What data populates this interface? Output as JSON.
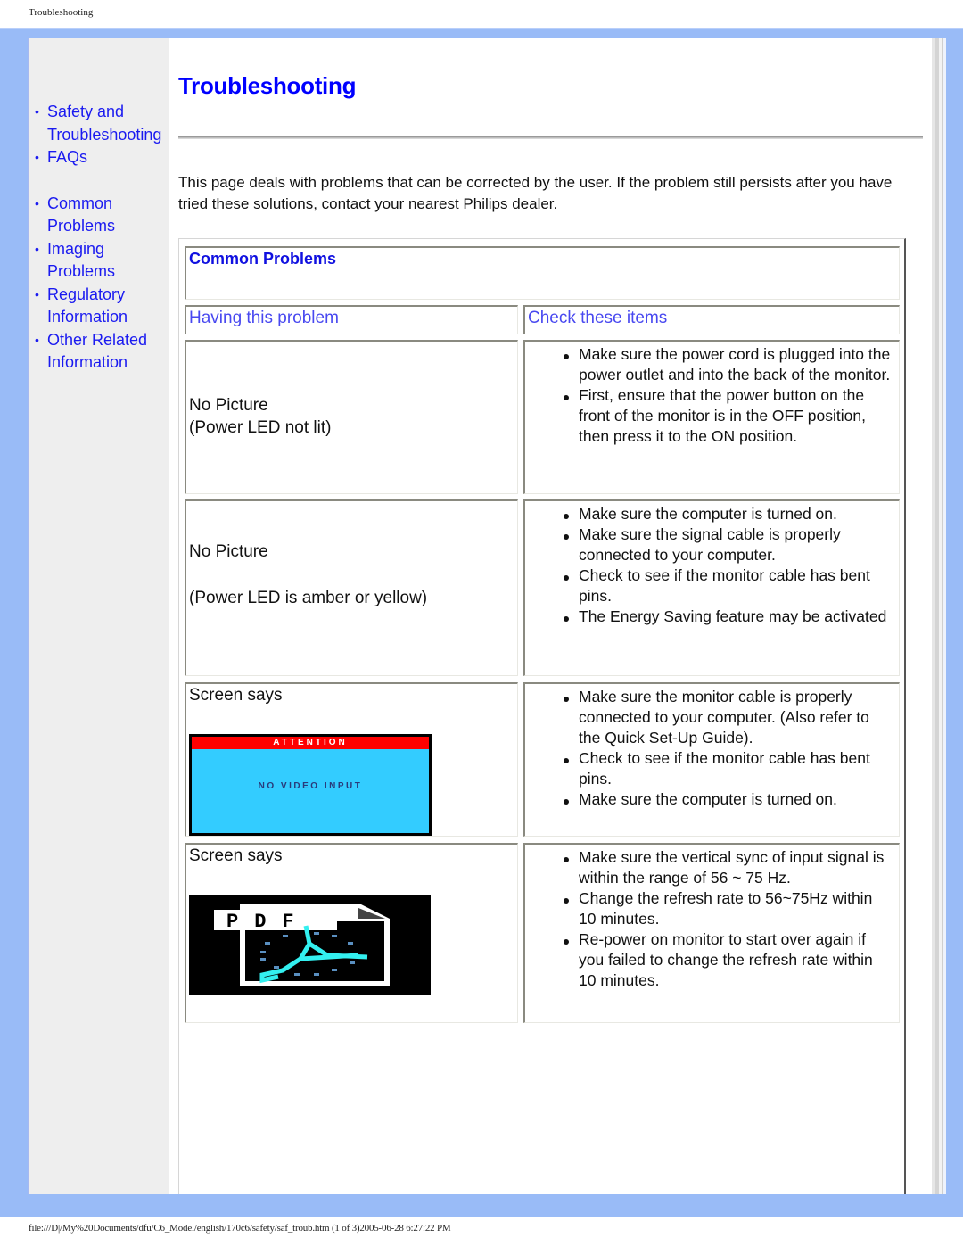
{
  "page_header": "Troubleshooting",
  "footer": "file:///D|/My%20Documents/dfu/C6_Model/english/170c6/safety/saf_troub.htm (1 of 3)2005-06-28 6:27:22 PM",
  "colors": {
    "frame": "#99bbf7",
    "sidebar": "#eeeeee",
    "link": "#1a1af0",
    "title": "#0000ff",
    "column_header": "#4848f0"
  },
  "sidebar": {
    "groups": [
      [
        {
          "label": "Safety and Troubleshooting",
          "icon": "bullet"
        },
        {
          "label": "FAQs",
          "icon": "bullet"
        }
      ],
      [
        {
          "label": "Common Problems",
          "icon": "bullet"
        },
        {
          "label": "Imaging Problems",
          "icon": "bullet"
        },
        {
          "label": "Regulatory Information",
          "icon": "bullet"
        },
        {
          "label": "Other Related Information",
          "icon": "bullet"
        }
      ]
    ]
  },
  "main": {
    "title": "Troubleshooting",
    "intro": "This page deals with problems that can be corrected by the user. If the problem still persists after you have tried these solutions, contact your nearest Philips dealer.",
    "section_title": "Common Problems",
    "columns": [
      "Having this problem",
      "Check these items"
    ],
    "rows": [
      {
        "problem": [
          "No Picture",
          "(Power LED not lit)"
        ],
        "checks": [
          "Make sure the power cord is plugged into the power outlet and into the back of the monitor.",
          "First, ensure that the power button on the front of the monitor is in the OFF position, then press it to the ON position."
        ]
      },
      {
        "problem": [
          "No Picture",
          "(Power LED is amber or yellow)"
        ],
        "checks": [
          "Make sure the computer is turned on.",
          "Make sure the signal cable is properly connected to your computer.",
          "Check to see if the monitor cable has bent pins.",
          "The Energy Saving feature may be activated"
        ]
      },
      {
        "problem": [
          "Screen says"
        ],
        "screen": {
          "type": "attention",
          "header": "ATTENTION",
          "message": "NO VIDEO INPUT"
        },
        "checks": [
          "Make sure the monitor cable is properly connected to your computer. (Also refer to the Quick Set-Up Guide).",
          "Check to see if the monitor cable has bent pins.",
          "Make sure the computer is turned on."
        ]
      },
      {
        "problem": [
          "Screen says"
        ],
        "screen": {
          "type": "pdf-clock",
          "label": "PDF"
        },
        "checks": [
          "Make sure the vertical sync of input signal is within the range of 56 ~ 75 Hz.",
          "Change the refresh rate to 56~75Hz within 10 minutes.",
          "Re-power on monitor to start over again if you failed to change the refresh rate within 10 minutes."
        ]
      }
    ]
  }
}
